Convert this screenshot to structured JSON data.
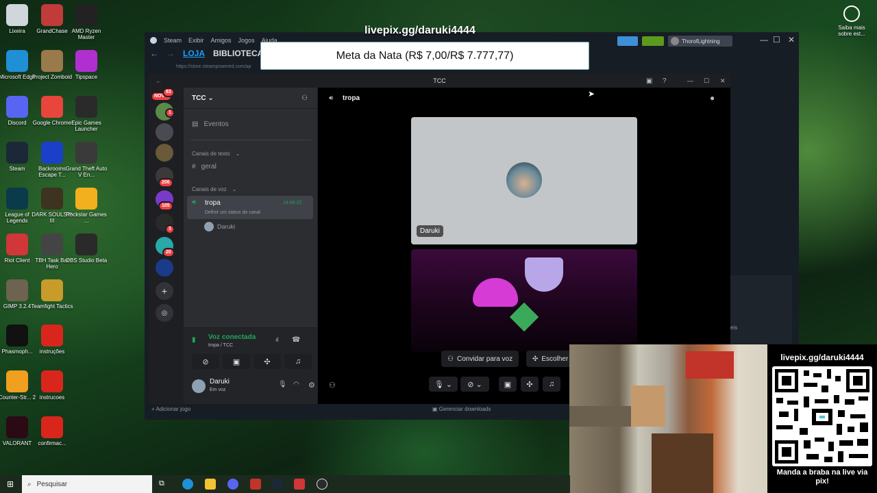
{
  "overlay": {
    "livepix_top": "livepix.gg/daruki4444",
    "meta_text": "Meta da Nata (R$ 7,00/R$ 7.777,77)",
    "qr_title": "livepix.gg/daruki4444",
    "qr_caption": "Manda a braba na live via pix!"
  },
  "desktop_icons": [
    {
      "label": "Lixeira",
      "icon": "recycle-bin-icon",
      "color": "#cfd6dc"
    },
    {
      "label": "GrandChase",
      "icon": "grandchase-icon",
      "color": "#c23b3b"
    },
    {
      "label": "AMD Ryzen Master",
      "icon": "amd-ryzen-icon",
      "color": "#222"
    },
    {
      "label": "Microsoft Edge",
      "icon": "edge-icon",
      "color": "#1f8fd6"
    },
    {
      "label": "Project Zomboid",
      "icon": "zomboid-icon",
      "color": "#9a7a4a"
    },
    {
      "label": "Tipspace",
      "icon": "tipspace-icon",
      "color": "#b02fd0"
    },
    {
      "label": "Discord",
      "icon": "discord-icon",
      "color": "#5865f2"
    },
    {
      "label": "Google Chrome",
      "icon": "chrome-icon",
      "color": "#e8453c"
    },
    {
      "label": "Epic Games Launcher",
      "icon": "epic-icon",
      "color": "#2a2a2a"
    },
    {
      "label": "Steam",
      "icon": "steam-icon",
      "color": "#1b2838"
    },
    {
      "label": "Backrooms Escape T...",
      "icon": "backrooms-icon",
      "color": "#1c3fc8"
    },
    {
      "label": "Grand Theft Auto V En...",
      "icon": "gta-icon",
      "color": "#3a3a3a"
    },
    {
      "label": "League of Legends",
      "icon": "lol-icon",
      "color": "#0b3a4a"
    },
    {
      "label": "DARK SOULS™ III",
      "icon": "darksouls-icon",
      "color": "#3d3320"
    },
    {
      "label": "Rockstar Games ...",
      "icon": "rockstar-icon",
      "color": "#f2b01e"
    },
    {
      "label": "Riot Client",
      "icon": "riot-icon",
      "color": "#d13639"
    },
    {
      "label": "TBH Task Bar Hero",
      "icon": "tbh-icon",
      "color": "#444"
    },
    {
      "label": "OBS Studio Beta",
      "icon": "obs-icon",
      "color": "#2a2a2a"
    },
    {
      "label": "GIMP 3.2.4",
      "icon": "gimp-icon",
      "color": "#6e6250"
    },
    {
      "label": "Teamfight Tactics",
      "icon": "tft-icon",
      "color": "#c89b2a"
    },
    {
      "label": "Phasmoph...",
      "icon": "phasmo-icon",
      "color": "#111"
    },
    {
      "label": "instruções",
      "icon": "pdf-icon",
      "color": "#d9261c"
    },
    {
      "label": "Counter-Str... 2",
      "icon": "cs2-icon",
      "color": "#f0a01e"
    },
    {
      "label": "instrucoes",
      "icon": "pdf-icon",
      "color": "#d9261c"
    },
    {
      "label": "VALORANT",
      "icon": "valorant-icon",
      "color": "#2a0a14"
    },
    {
      "label": "confirmac...",
      "icon": "pdf-icon",
      "color": "#d9261c"
    }
  ],
  "right_widget": {
    "label": "Saiba mais sobre est...",
    "icon": "info-lens-icon"
  },
  "steam": {
    "menu": [
      "Steam",
      "Exibir",
      "Amigos",
      "Jogos",
      "Ajuda"
    ],
    "nav": [
      "LOJA",
      "BIBLIOTECA"
    ],
    "url": "https://store.steampowered.com/ap",
    "username": "ThorofLightning",
    "add_game": "Adicionar jogo",
    "manage_downloads": "Gerenciar downloads",
    "side_text": "eis"
  },
  "discord": {
    "window_title": "TCC",
    "server_name": "TCC",
    "new_badge": "NOVO",
    "badges": [
      "83",
      "1",
      "206",
      "105",
      "3",
      "20"
    ],
    "events": "Eventos",
    "text_category": "Canais de texto",
    "text_channel": "geral",
    "voice_category": "Canais de voz",
    "voice_channel": "tropa",
    "voice_time": "14:06:22",
    "voice_status": "Definir um status do canal",
    "voice_member": "Daruki",
    "connected_title": "Voz conectada",
    "connected_sub": "tropa / TCC",
    "user_name": "Daruki",
    "user_status": "Em voz",
    "stage_title": "tropa",
    "tile_name": "Daruki",
    "invite_button": "Convidar para voz",
    "choose_button": "Escolher"
  },
  "taskbar": {
    "search_placeholder": "Pesquisar"
  }
}
